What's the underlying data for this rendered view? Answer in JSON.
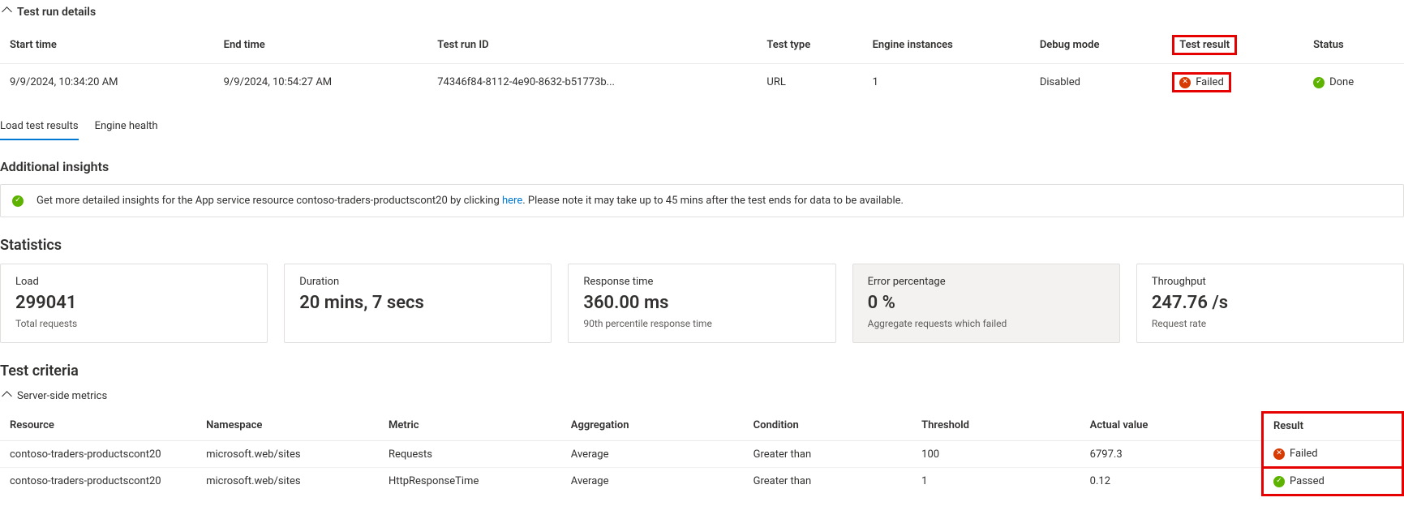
{
  "details_section_title": "Test run details",
  "details_columns": {
    "start_time": "Start time",
    "end_time": "End time",
    "test_run_id": "Test run ID",
    "test_type": "Test type",
    "engine_instances": "Engine instances",
    "debug_mode": "Debug mode",
    "test_result": "Test result",
    "status": "Status"
  },
  "details_row": {
    "start_time": "9/9/2024, 10:34:20 AM",
    "end_time": "9/9/2024, 10:54:27 AM",
    "test_run_id": "74346f84-8112-4e90-8632-b51773b...",
    "test_type": "URL",
    "engine_instances": "1",
    "debug_mode": "Disabled",
    "test_result": "Failed",
    "status": "Done"
  },
  "tabs": {
    "load_test_results": "Load test results",
    "engine_health": "Engine health"
  },
  "insights_heading": "Additional insights",
  "insight_text_pre": "Get more detailed insights for the App service resource contoso-traders-productscont20 by clicking ",
  "insight_link": "here",
  "insight_text_post": ". Please note it may take up to 45 mins after the test ends for data to be available.",
  "statistics_heading": "Statistics",
  "stats": {
    "load": {
      "label": "Load",
      "value": "299041",
      "desc": "Total requests"
    },
    "duration": {
      "label": "Duration",
      "value": "20 mins, 7 secs",
      "desc": ""
    },
    "response": {
      "label": "Response time",
      "value": "360.00 ms",
      "desc": "90th percentile response time"
    },
    "error": {
      "label": "Error percentage",
      "value": "0 %",
      "desc": "Aggregate requests which failed"
    },
    "throughput": {
      "label": "Throughput",
      "value": "247.76 /s",
      "desc": "Request rate"
    }
  },
  "criteria_heading": "Test criteria",
  "criteria_sub_heading": "Server-side metrics",
  "criteria_columns": {
    "resource": "Resource",
    "namespace": "Namespace",
    "metric": "Metric",
    "aggregation": "Aggregation",
    "condition": "Condition",
    "threshold": "Threshold",
    "actual": "Actual value",
    "result": "Result"
  },
  "criteria_rows": [
    {
      "resource": "contoso-traders-productscont20",
      "namespace": "microsoft.web/sites",
      "metric": "Requests",
      "aggregation": "Average",
      "condition": "Greater than",
      "threshold": "100",
      "actual": "6797.3",
      "result": "Failed",
      "result_type": "fail"
    },
    {
      "resource": "contoso-traders-productscont20",
      "namespace": "microsoft.web/sites",
      "metric": "HttpResponseTime",
      "aggregation": "Average",
      "condition": "Greater than",
      "threshold": "1",
      "actual": "0.12",
      "result": "Passed",
      "result_type": "success"
    }
  ]
}
